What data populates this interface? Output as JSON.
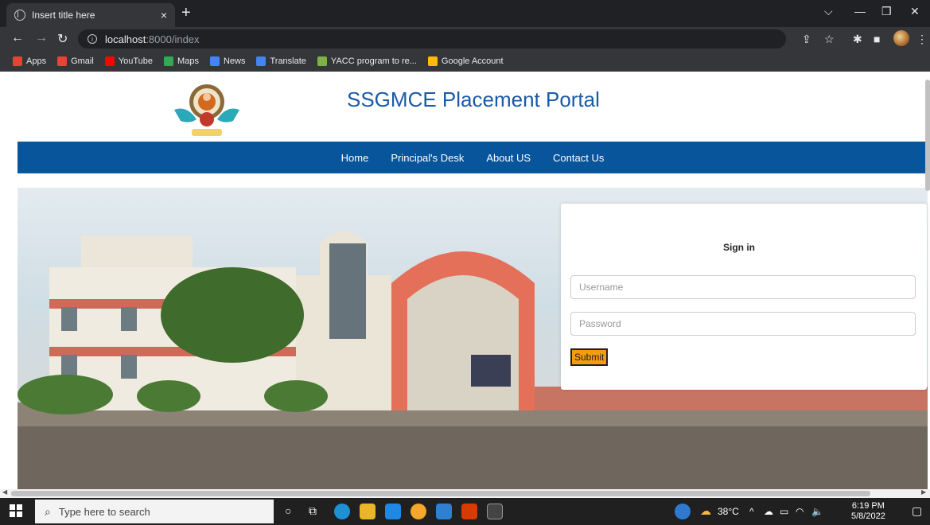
{
  "browser": {
    "tab_title": "Insert title here",
    "tab_close": "×",
    "new_tab": "+",
    "url_host": "localhost",
    "url_rest": ":8000/index",
    "bookmarks": [
      {
        "label": "Apps",
        "color": "#e94235"
      },
      {
        "label": "Gmail",
        "color": "#ea4335"
      },
      {
        "label": "YouTube",
        "color": "#ff0000"
      },
      {
        "label": "Maps",
        "color": "#34a853"
      },
      {
        "label": "News",
        "color": "#4285f4"
      },
      {
        "label": "Translate",
        "color": "#4285f4"
      },
      {
        "label": "YACC program to re...",
        "color": "#7cb342"
      },
      {
        "label": "Google Account",
        "color": "#fbbc04"
      }
    ]
  },
  "site": {
    "title": "SSGMCE Placement Portal",
    "nav": [
      "Home",
      "Principal's Desk",
      "About US",
      "Contact Us"
    ]
  },
  "signin": {
    "title": "Sign in",
    "username_placeholder": "Username",
    "password_placeholder": "Password",
    "submit_label": "Submit"
  },
  "taskbar": {
    "search_placeholder": "Type here to search",
    "temperature": "38°C",
    "time": "6:19 PM",
    "date": "5/8/2022"
  },
  "colors": {
    "title_blue": "#1b5aa6",
    "nav_blue": "#08559c",
    "submit_orange": "#f39c12"
  }
}
